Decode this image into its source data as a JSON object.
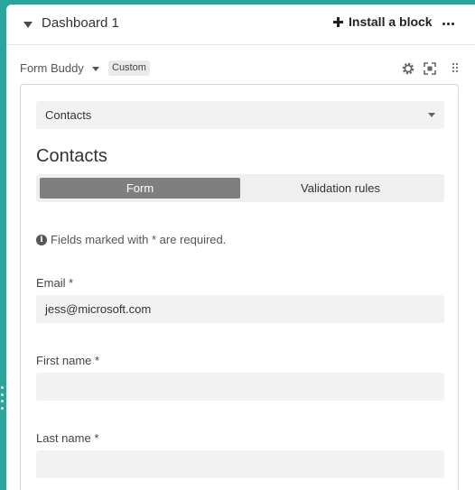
{
  "dashboard": {
    "title": "Dashboard 1",
    "install_label": "Install a block"
  },
  "block": {
    "name": "Form Buddy",
    "badge": "Custom"
  },
  "form": {
    "table_select": "Contacts",
    "title": "Contacts",
    "tabs": [
      {
        "label": "Form"
      },
      {
        "label": "Validation rules"
      }
    ],
    "note": "Fields marked with * are required.",
    "fields": [
      {
        "label": "Email *",
        "value": "jess@microsoft.com"
      },
      {
        "label": "First name *",
        "value": ""
      },
      {
        "label": "Last name *",
        "value": ""
      }
    ]
  },
  "colors": {
    "background": "#2aa59b",
    "active_tab": "#7f7f7f",
    "input_bg": "#f2f2f2"
  },
  "icons": [
    "chevron-down-icon",
    "plus-icon",
    "more-icon",
    "gear-icon",
    "expand-icon",
    "drag-handle-icon",
    "info-icon"
  ]
}
